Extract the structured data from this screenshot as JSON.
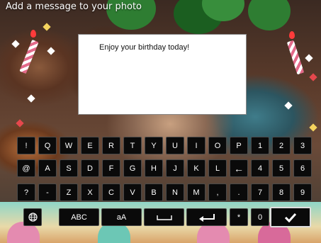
{
  "header": {
    "title": "Add a message to your photo"
  },
  "message": {
    "text": "Enjoy your birthday today!"
  },
  "keyboard": {
    "row1": [
      "!",
      "Q",
      "W",
      "E",
      "R",
      "T",
      "Y",
      "U",
      "I",
      "O",
      "P",
      "1",
      "2",
      "3"
    ],
    "row2": [
      "@",
      "A",
      "S",
      "D",
      "F",
      "G",
      "H",
      "J",
      "K",
      "L",
      "←",
      "4",
      "5",
      "6"
    ],
    "row3": [
      "?",
      "-",
      "Z",
      "X",
      "C",
      "V",
      "B",
      "N",
      "M",
      ",",
      ".",
      "7",
      "8",
      "9"
    ],
    "row4": {
      "globe_icon": "globe-icon",
      "abc": "ABC",
      "case": "aA",
      "space_icon": "space-icon",
      "enter_icon": "enter-icon",
      "star": "*",
      "zero": "0",
      "confirm_icon": "checkmark-icon"
    }
  }
}
